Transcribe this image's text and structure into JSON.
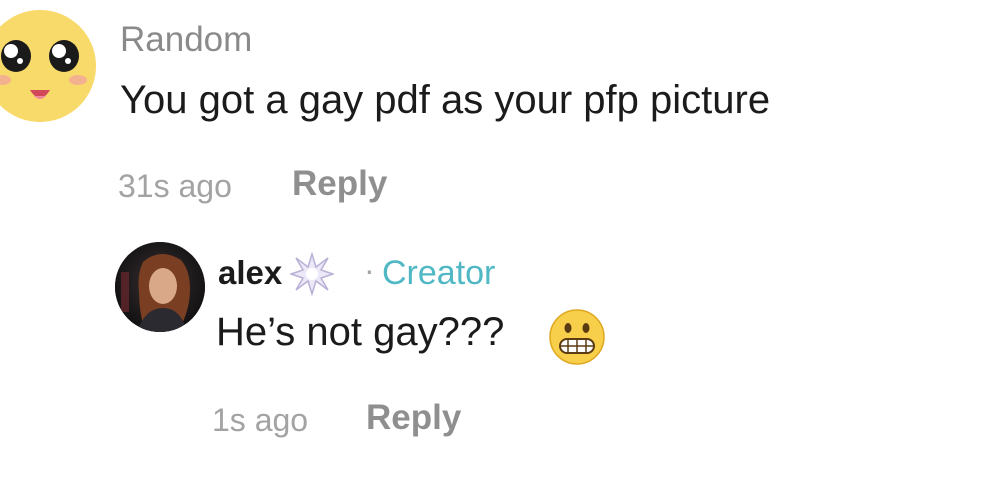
{
  "comments": [
    {
      "avatar_icon": "cute-face-icon",
      "username": "Random",
      "text": "You got a gay pdf as your pfp picture",
      "time": "31s ago",
      "reply_label": "Reply",
      "avatar_color": "#f8da6a"
    },
    {
      "avatar_icon": "profile-photo",
      "username": "alex",
      "badge_icon": "starburst-badge-icon",
      "separator": "·",
      "role_label": "Creator",
      "text": "He’s not gay???",
      "text_emoji": "grimacing-face-icon",
      "time": "1s ago",
      "reply_label": "Reply",
      "role_color": "#4fb8c4"
    }
  ]
}
